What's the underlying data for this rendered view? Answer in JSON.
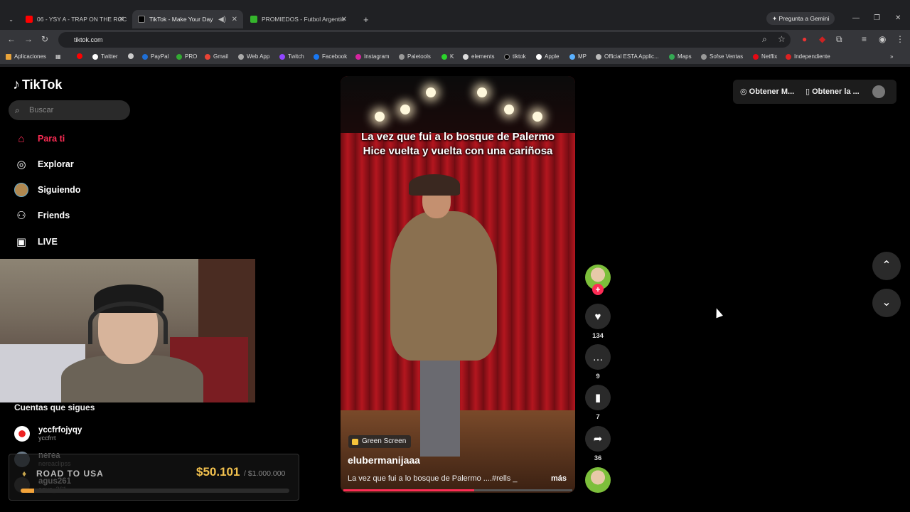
{
  "browser": {
    "tabs": [
      {
        "title": "06 - YSY A - TRAP ON THE ROC",
        "color": "#ff0000"
      },
      {
        "title": "TikTok - Make Your Day",
        "color": "#000000"
      },
      {
        "title": "PROMIEDOS - Futbol Argentin",
        "color": "#35b52c"
      }
    ],
    "new_tab": "+",
    "gemini": "Pregunta a Gemini",
    "url": "tiktok.com",
    "bookmarks": [
      "Aplicaciones",
      "Twitter",
      "PayPal",
      "PRO",
      "Gmail",
      "Web App",
      "Twitch",
      "Facebook",
      "Instagram",
      "Paletools",
      "K",
      "elements",
      "tiktok",
      "Apple",
      "MP",
      "Official ESTA Applic...",
      "Maps",
      "Sofse Ventas",
      "Netflix",
      "Independiente"
    ]
  },
  "tiktok": {
    "logo": "TikTok",
    "search_placeholder": "Buscar",
    "nav": [
      {
        "label": "Para ti",
        "icon": "home-icon"
      },
      {
        "label": "Explorar",
        "icon": "compass-icon"
      },
      {
        "label": "Siguiendo",
        "icon": "following-avatar-icon"
      },
      {
        "label": "Friends",
        "icon": "friends-icon"
      },
      {
        "label": "LIVE",
        "icon": "live-icon"
      }
    ],
    "following_title": "Cuentas que sigues",
    "following": [
      {
        "name": "yccfrfojyqy",
        "handle": "yccfrrt"
      },
      {
        "name": "nerea",
        "handle": "nereaclipss"
      },
      {
        "name": "agus261",
        "handle": "agus_261"
      }
    ],
    "overlay": {
      "label": "ROAD TO USA",
      "amount": "$50.101",
      "goal": "/ $1.000.000",
      "progress": 0.05
    },
    "video": {
      "caption_line1": "La vez que fui a lo bosque de Palermo",
      "caption_line2": "Hice vuelta y vuelta con una cariñosa",
      "badge": "Green Screen",
      "author": "elubermanijaaa",
      "description": "La vez que fui a lo bosque de Palermo ....#rells _",
      "more": "más",
      "progress": 0.57
    },
    "actions": {
      "likes": "134",
      "comments": "9",
      "saves": "7",
      "shares": "36"
    },
    "top_right": {
      "get_app": "Obtener M...",
      "get_device": "Obtener la ..."
    }
  }
}
